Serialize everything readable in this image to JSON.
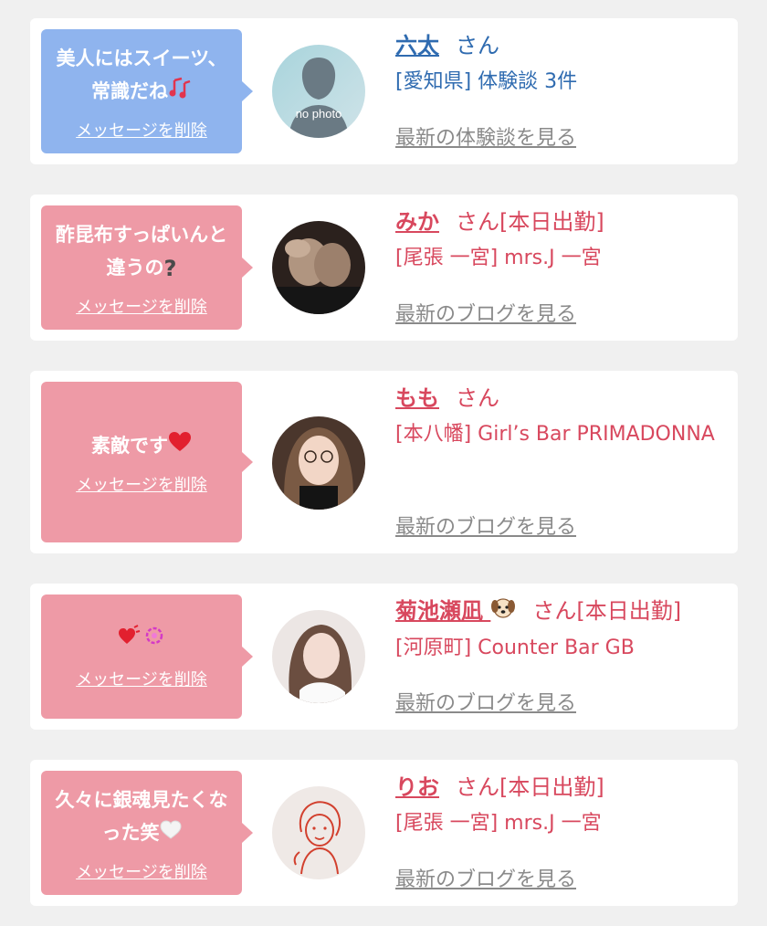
{
  "delete_label": "メッセージを削除",
  "colors": {
    "blue_bubble": "#8fb4ee",
    "pink_bubble": "#ee9aa6",
    "blue_text": "#2f6bb0",
    "pink_text": "#d8485e",
    "link_gray": "#8a8a8a"
  },
  "cards": [
    {
      "message": "美人にはスイーツ、常識だね",
      "message_icon": "music-notes-icon",
      "name": "六太",
      "suffix": "さん",
      "location": "[愛知県] 体験談 3件",
      "more": "最新の体験談を見る",
      "avatar_text": "no photo"
    },
    {
      "message": "酢昆布すっぱいんと違うの",
      "message_icon": "question-mark-icon",
      "name": "みか",
      "suffix": "さん[本日出勤]",
      "location": "[尾張 一宮] mrs.J 一宮",
      "more": "最新のブログを見る"
    },
    {
      "message": "素敵です",
      "message_icon": "red-heart-icon",
      "name": "もも",
      "suffix": "さん",
      "location": "[本八幡] Girl’s Bar PRIMADONNA",
      "more": "最新のブログを見る"
    },
    {
      "message": "",
      "message_icon": "heart-sparkle-icon",
      "name": "菊池瀬凪",
      "name_icon": "dog-face-icon",
      "suffix": "さん[本日出勤]",
      "location": "[河原町] Counter Bar GB",
      "more": "最新のブログを見る"
    },
    {
      "message": "久々に銀魂見たくなった笑",
      "message_icon": "white-heart-icon",
      "name": "りお",
      "suffix": "さん[本日出勤]",
      "location": "[尾張 一宮] mrs.J 一宮",
      "more": "最新のブログを見る"
    }
  ]
}
